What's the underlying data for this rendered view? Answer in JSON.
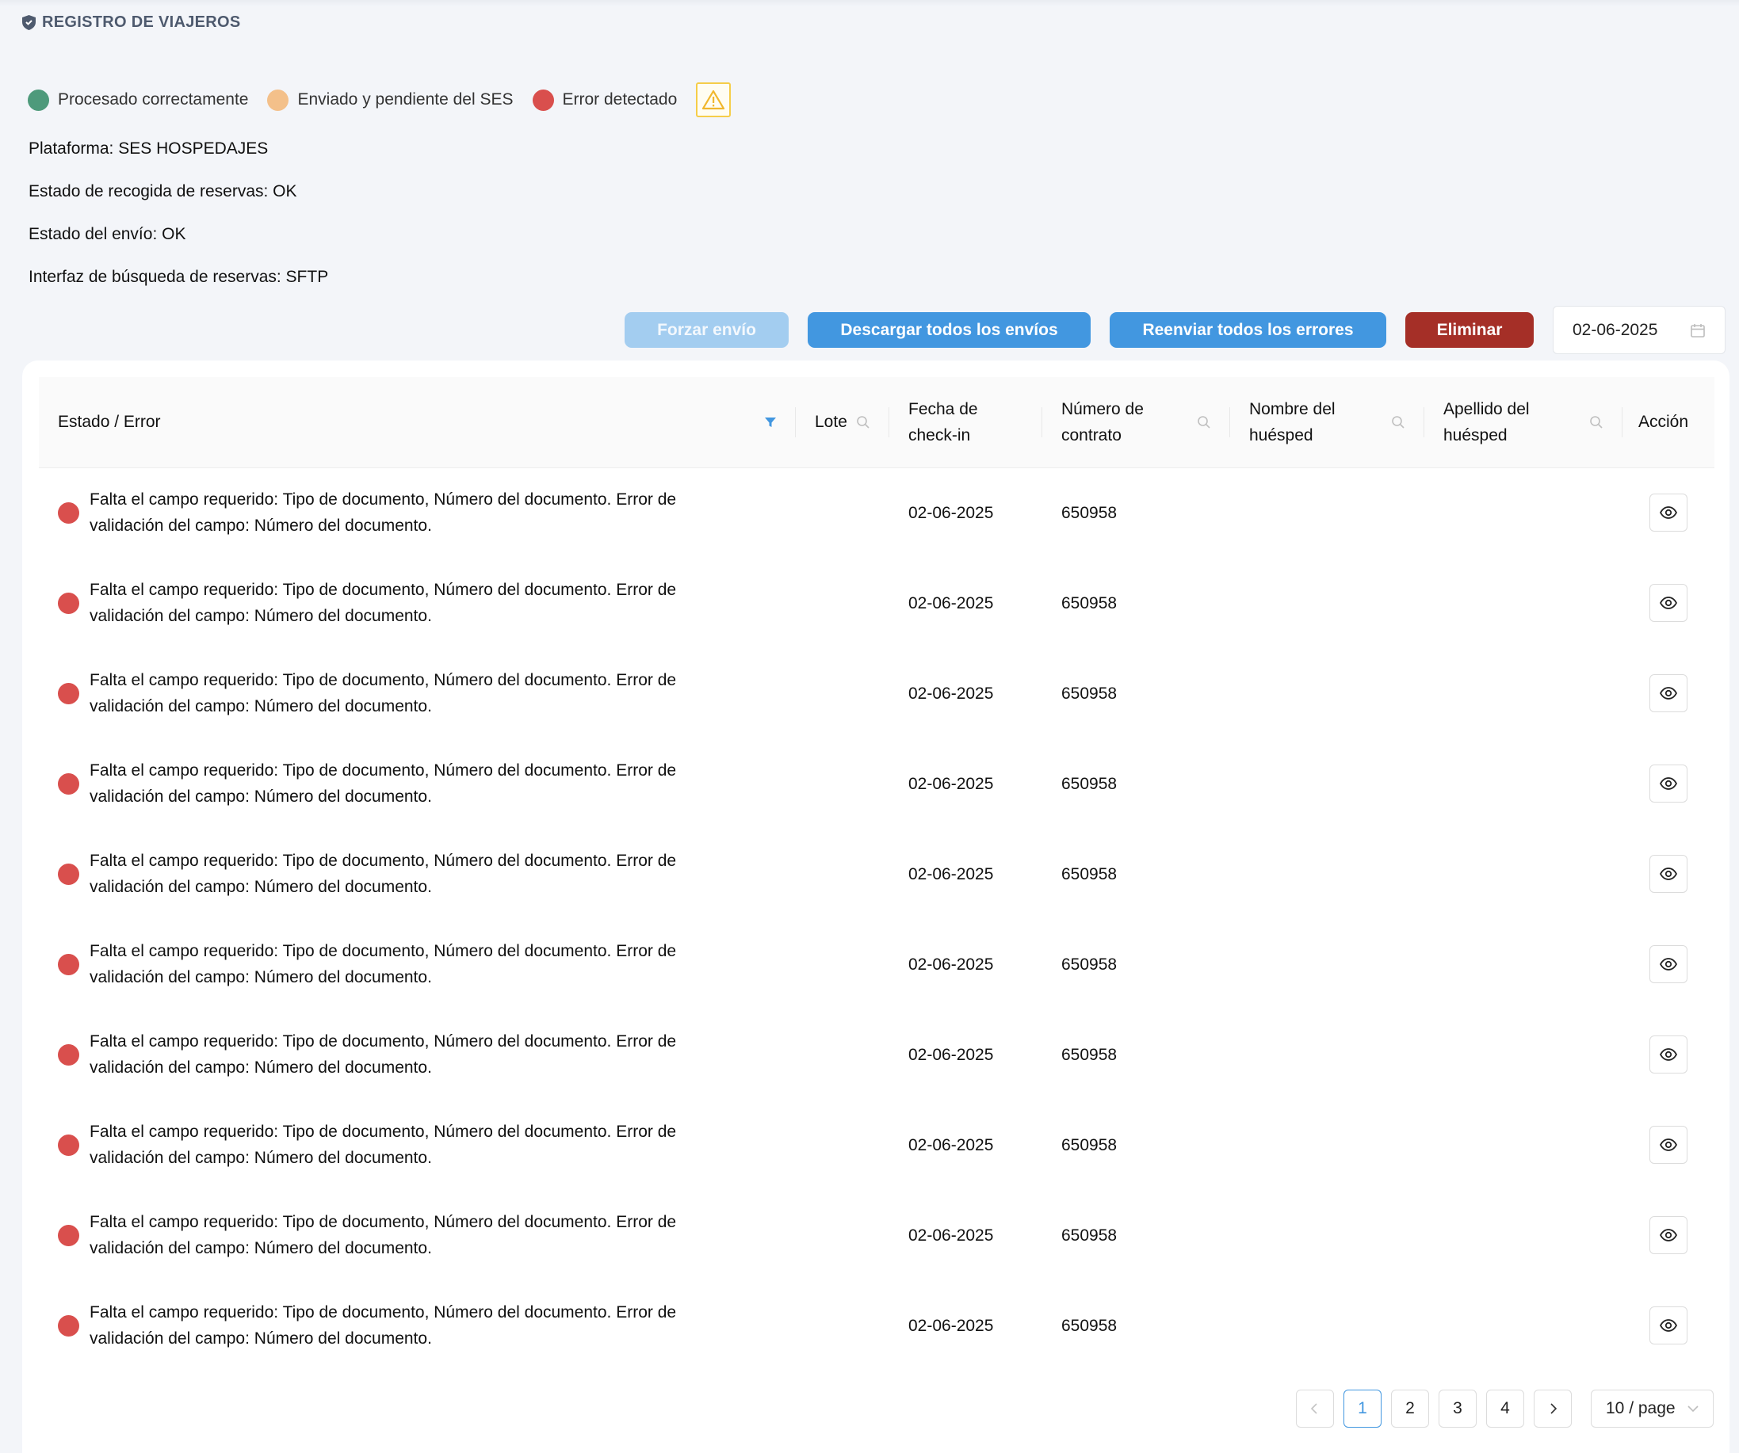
{
  "page": {
    "title": "REGISTRO DE VIAJEROS"
  },
  "legend": {
    "items": [
      {
        "label": "Procesado correctamente",
        "color": "#4e9a7b"
      },
      {
        "label": "Enviado y pendiente del SES",
        "color": "#f3c08a"
      },
      {
        "label": "Error detectado",
        "color": "#d94f4d"
      }
    ],
    "warning_icon": "warning-triangle-icon"
  },
  "info": {
    "platform": "Plataforma: SES HOSPEDAJES",
    "booking_status": "Estado de recogida de reservas: OK",
    "send_status": "Estado del envío: OK",
    "search_interface": "Interfaz de búsqueda de reservas: SFTP"
  },
  "actions": {
    "force_send": "Forzar envío",
    "download_all": "Descargar todos los envíos",
    "resend_errors": "Reenviar todos los errores",
    "delete": "Eliminar",
    "date": "02-06-2025"
  },
  "table": {
    "columns": {
      "state": "Estado / Error",
      "batch": "Lote",
      "checkin_1": "Fecha de",
      "checkin_2": "check-in",
      "contract_1": "Número de",
      "contract_2": "contrato",
      "guest_name_1": "Nombre del",
      "guest_name_2": "huésped",
      "guest_surname_1": "Apellido del",
      "guest_surname_2": "huésped",
      "action": "Acción"
    },
    "rows": [
      {
        "status": "error",
        "error_1": "Falta el campo requerido: Tipo de documento, Número del documento. Error de",
        "error_2": "validación del campo: Número del documento.",
        "batch": "",
        "checkin": "02-06-2025",
        "contract": "650958",
        "name": "",
        "surname": ""
      },
      {
        "status": "error",
        "error_1": "Falta el campo requerido: Tipo de documento, Número del documento. Error de",
        "error_2": "validación del campo: Número del documento.",
        "batch": "",
        "checkin": "02-06-2025",
        "contract": "650958",
        "name": "",
        "surname": ""
      },
      {
        "status": "error",
        "error_1": "Falta el campo requerido: Tipo de documento, Número del documento. Error de",
        "error_2": "validación del campo: Número del documento.",
        "batch": "",
        "checkin": "02-06-2025",
        "contract": "650958",
        "name": "",
        "surname": ""
      },
      {
        "status": "error",
        "error_1": "Falta el campo requerido: Tipo de documento, Número del documento. Error de",
        "error_2": "validación del campo: Número del documento.",
        "batch": "",
        "checkin": "02-06-2025",
        "contract": "650958",
        "name": "",
        "surname": ""
      },
      {
        "status": "error",
        "error_1": "Falta el campo requerido: Tipo de documento, Número del documento. Error de",
        "error_2": "validación del campo: Número del documento.",
        "batch": "",
        "checkin": "02-06-2025",
        "contract": "650958",
        "name": "",
        "surname": ""
      },
      {
        "status": "error",
        "error_1": "Falta el campo requerido: Tipo de documento, Número del documento. Error de",
        "error_2": "validación del campo: Número del documento.",
        "batch": "",
        "checkin": "02-06-2025",
        "contract": "650958",
        "name": "",
        "surname": ""
      },
      {
        "status": "error",
        "error_1": "Falta el campo requerido: Tipo de documento, Número del documento. Error de",
        "error_2": "validación del campo: Número del documento.",
        "batch": "",
        "checkin": "02-06-2025",
        "contract": "650958",
        "name": "",
        "surname": ""
      },
      {
        "status": "error",
        "error_1": "Falta el campo requerido: Tipo de documento, Número del documento. Error de",
        "error_2": "validación del campo: Número del documento.",
        "batch": "",
        "checkin": "02-06-2025",
        "contract": "650958",
        "name": "",
        "surname": ""
      },
      {
        "status": "error",
        "error_1": "Falta el campo requerido: Tipo de documento, Número del documento. Error de",
        "error_2": "validación del campo: Número del documento.",
        "batch": "",
        "checkin": "02-06-2025",
        "contract": "650958",
        "name": "",
        "surname": ""
      },
      {
        "status": "error",
        "error_1": "Falta el campo requerido: Tipo de documento, Número del documento. Error de",
        "error_2": "validación del campo: Número del documento.",
        "batch": "",
        "checkin": "02-06-2025",
        "contract": "650958",
        "name": "",
        "surname": ""
      }
    ]
  },
  "pagination": {
    "pages": [
      "1",
      "2",
      "3",
      "4"
    ],
    "current": "1",
    "page_size": "10 / page"
  },
  "colors": {
    "primary": "#4297e0",
    "primary_disabled": "#a3cdf0",
    "danger": "#a52f27",
    "status_error": "#d94f4d",
    "status_ok": "#4e9a7b",
    "status_pending": "#f3c08a",
    "warning": "#f5cd49"
  }
}
